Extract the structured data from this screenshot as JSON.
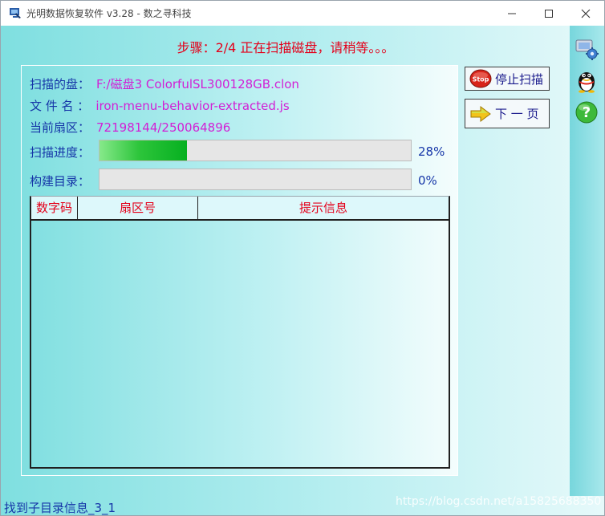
{
  "window": {
    "title": "光明数据恢复软件 v3.28 - 数之寻科技"
  },
  "step": {
    "title": "步骤：2/4 正在扫描磁盘，请稍等。。。"
  },
  "info": {
    "disk_label": "扫描的盘：",
    "disk_value": "F:/磁盘3 ColorfulSL300128GB.clon",
    "file_label": "文 件 名 ：",
    "file_value": "iron-menu-behavior-extracted.js",
    "sector_label": "当前扇区：",
    "sector_value": "72198144/250064896"
  },
  "progress": {
    "scan_label": "扫描进度：",
    "scan_percent_text": "28%",
    "scan_fraction": 0.28,
    "build_label": "构建目录：",
    "build_percent_text": "0%",
    "build_fraction": 0
  },
  "table": {
    "columns": [
      "数字码",
      "扇区号",
      "提示信息"
    ],
    "rows": []
  },
  "buttons": {
    "stop_label": "停止扫描",
    "stop_icon_text": "Stop",
    "next_label": "下 一 页"
  },
  "sidebar": {
    "icons": [
      "settings-icon",
      "qq-penguin-icon",
      "help-icon"
    ],
    "help_glyph": "?"
  },
  "status": {
    "text": "找到子目录信息_3_1"
  },
  "watermark": {
    "text": "https://blog.csdn.net/a15825688350"
  },
  "colors": {
    "accent_red": "#e4001a",
    "label_blue": "#1636a8",
    "value_magenta": "#d21fd5",
    "progress_green": "#06b020"
  }
}
